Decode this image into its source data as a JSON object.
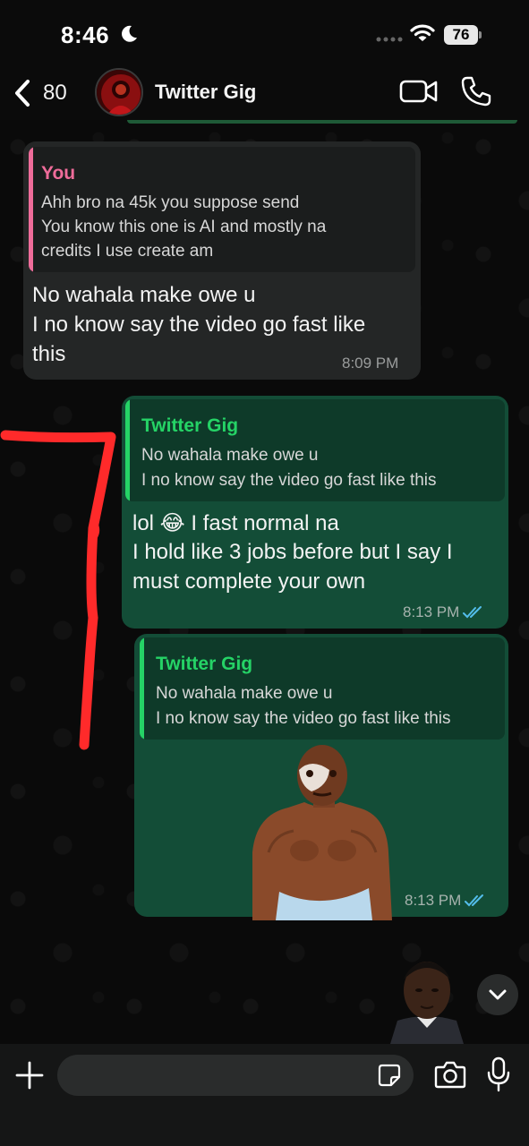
{
  "status_bar": {
    "time": "8:46",
    "battery": "76"
  },
  "header": {
    "back_count": "80",
    "contact_name": "Twitter Gig"
  },
  "messages": [
    {
      "direction": "incoming",
      "quote_author": "You",
      "quote_lines": [
        "Ahh bro na 45k you suppose send",
        "You know this one is AI and mostly na",
        "credits I use create am"
      ],
      "text_lines": [
        "No wahala make owe u",
        "I no know say the video go fast like",
        "this"
      ],
      "time": "8:09 PM"
    },
    {
      "direction": "outgoing",
      "quote_author": "Twitter Gig",
      "quote_lines": [
        "No wahala make owe u",
        "I no know say the video go fast like this"
      ],
      "text_lines": [
        "lol 😂 I fast normal na",
        "I hold like 3 jobs before but I say I",
        "must complete your own"
      ],
      "time": "8:13 PM"
    },
    {
      "direction": "outgoing",
      "quote_author": "Twitter Gig",
      "quote_lines": [
        "No wahala make owe u",
        "I no know say the video go fast like this"
      ],
      "time": "8:13 PM"
    }
  ],
  "colors": {
    "you_accent": "#ef6c9a",
    "contact_accent": "#25d366",
    "annotation": "#ff2a2a",
    "read_ticks": "#53bdeb"
  },
  "icons": [
    "moon-icon",
    "signal-icon",
    "wifi-icon",
    "back-chevron-icon",
    "video-call-icon",
    "phone-call-icon",
    "read-ticks-icon",
    "chevron-down-icon",
    "plus-icon",
    "sticker-icon",
    "camera-icon",
    "microphone-icon"
  ],
  "composer": {
    "placeholder": ""
  }
}
